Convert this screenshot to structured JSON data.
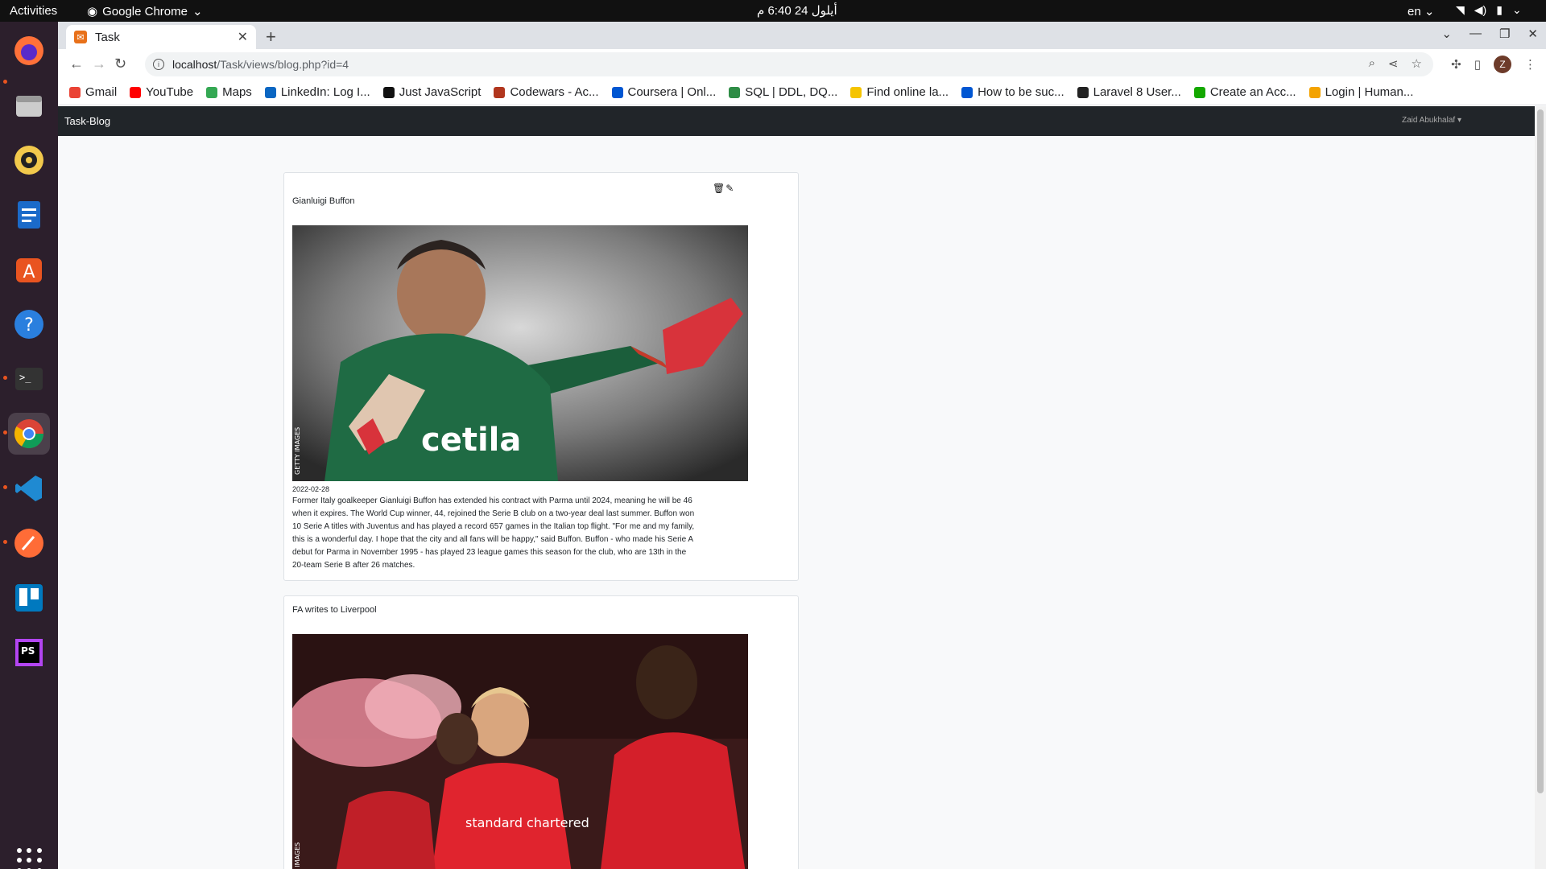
{
  "topbar": {
    "activities": "Activities",
    "app": "Google Chrome",
    "clock": "أيلول 24  6:40 م",
    "lang": "en"
  },
  "browser": {
    "tab_title": "Task",
    "url_host": "localhost",
    "url_path": "/Task/views/blog.php?id=4",
    "avatar_letter": "Z",
    "bookmarks": [
      {
        "label": "Gmail",
        "color": "#ea4335"
      },
      {
        "label": "YouTube",
        "color": "#ff0000"
      },
      {
        "label": "Maps",
        "color": "#34a853"
      },
      {
        "label": "LinkedIn: Log I...",
        "color": "#0a66c2"
      },
      {
        "label": "Just JavaScript",
        "color": "#111111"
      },
      {
        "label": "Codewars - Ac...",
        "color": "#b1361e"
      },
      {
        "label": "Coursera | Onl...",
        "color": "#0056d2"
      },
      {
        "label": "SQL | DDL, DQ...",
        "color": "#2f8d46"
      },
      {
        "label": "Find online la...",
        "color": "#f5c400"
      },
      {
        "label": "How to be suc...",
        "color": "#0056d2"
      },
      {
        "label": "Laravel 8 User...",
        "color": "#222222"
      },
      {
        "label": "Create an Acc...",
        "color": "#14a800"
      },
      {
        "label": "Login | Human...",
        "color": "#f4a300"
      }
    ]
  },
  "site": {
    "brand": "Task-Blog",
    "user": "Zaid Abukhalaf"
  },
  "posts": [
    {
      "title": "Gianluigi Buffon",
      "date": "2022-02-28",
      "image_caption": "GETTY IMAGES",
      "jersey_text": "cetila",
      "body": "Former Italy goalkeeper Gianluigi Buffon has extended his contract with Parma until 2024, meaning he will be 46 when it expires. The World Cup winner, 44, rejoined the Serie B club on a two-year deal last summer. Buffon won 10 Serie A titles with Juventus and has played a record 657 games in the Italian top flight. \"For me and my family, this is a wonderful day. I hope that the city and all fans will be happy,\" said Buffon. Buffon - who made his Serie A debut for Parma in November 1995 - has played 23 league games this season for the club, who are 13th in the 20-team Serie B after 26 matches."
    },
    {
      "title": "FA writes to Liverpool",
      "image_caption": "GETTY IMAGES",
      "sponsor_text": "standard chartered"
    }
  ]
}
